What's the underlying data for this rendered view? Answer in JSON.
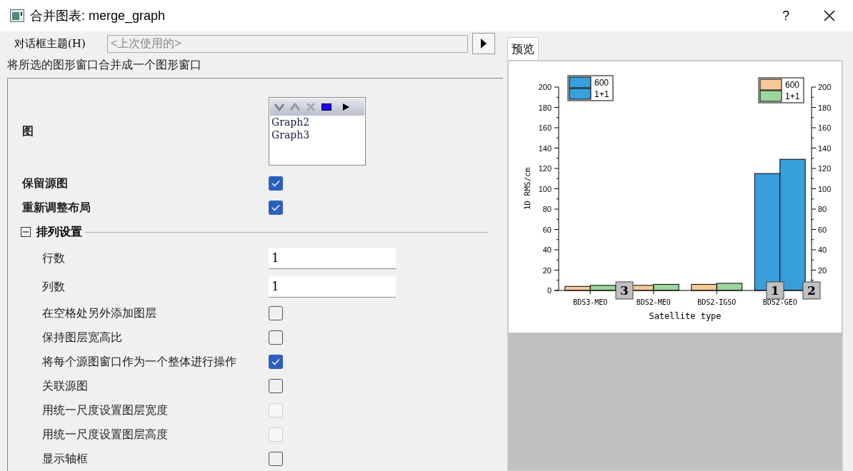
{
  "window": {
    "title": "合并图表: merge_graph",
    "help": "?"
  },
  "dialog_theme": {
    "label": "对话框主题(H)",
    "placeholder": "<上次使用的>"
  },
  "description": "将所选的图形窗口合并成一个图形窗口",
  "settings": [
    {
      "kind": "list",
      "label": "图",
      "items": [
        "Graph2",
        "Graph3"
      ]
    },
    {
      "kind": "checkbox",
      "label": "保留源图",
      "checked": true,
      "disabled": false
    },
    {
      "kind": "checkbox",
      "label": "重新调整布局",
      "checked": true,
      "disabled": false
    },
    {
      "kind": "section",
      "label": "排列设置",
      "expanded": true,
      "children": [
        {
          "kind": "input",
          "label": "行数",
          "value": "1"
        },
        {
          "kind": "input",
          "label": "列数",
          "value": "1"
        },
        {
          "kind": "checkbox",
          "label": "在空格处另外添加图层",
          "checked": false,
          "disabled": false
        },
        {
          "kind": "checkbox",
          "label": "保持图层宽高比",
          "checked": false,
          "disabled": false
        },
        {
          "kind": "checkbox",
          "label": "将每个源图窗口作为一个整体进行操作",
          "checked": true,
          "disabled": false
        },
        {
          "kind": "checkbox",
          "label": "关联源图",
          "checked": false,
          "disabled": false
        },
        {
          "kind": "checkbox",
          "label": "用统一尺度设置图层宽度",
          "checked": false,
          "disabled": true
        },
        {
          "kind": "checkbox",
          "label": "用统一尺度设置图层高度",
          "checked": false,
          "disabled": true
        },
        {
          "kind": "checkbox",
          "label": "显示轴框",
          "checked": false,
          "disabled": false
        }
      ]
    }
  ],
  "preview": {
    "tab": {
      "label": "预览",
      "selected": true
    },
    "layer_badges": [
      "3",
      "1",
      "2"
    ],
    "left_axis_ticks": [
      "200",
      "180",
      "160",
      "140",
      "120",
      "100",
      "80",
      "60",
      "40",
      "20",
      "0"
    ],
    "right_axis_ticks": [
      "200",
      "180",
      "160",
      "140",
      "120",
      "100",
      "80",
      "60",
      "40",
      "20"
    ],
    "chart_data": {
      "type": "bar",
      "xlabel": "Satellite type",
      "ylabel": "1D RMS/cm",
      "categories": [
        "BDS3-MEO",
        "BDS2-MEO",
        "BDS2-IGSO",
        "BDS2-GEO"
      ],
      "series": [
        {
          "name": "600",
          "color": "#379fdb",
          "values": [
            null,
            null,
            null,
            115
          ]
        },
        {
          "name": "1+1",
          "color": "#379fdb",
          "values": [
            null,
            null,
            null,
            129
          ]
        },
        {
          "name": "600",
          "color": "#f9c897",
          "values": [
            4,
            5,
            6,
            null
          ]
        },
        {
          "name": "1+1",
          "color": "#9bd69b",
          "values": [
            5,
            6,
            7,
            null
          ]
        }
      ],
      "legend": "top",
      "ylim": [
        0,
        200
      ],
      "yticks": [
        0,
        20,
        40,
        60,
        80,
        100,
        120,
        140,
        160,
        180,
        200
      ]
    }
  }
}
